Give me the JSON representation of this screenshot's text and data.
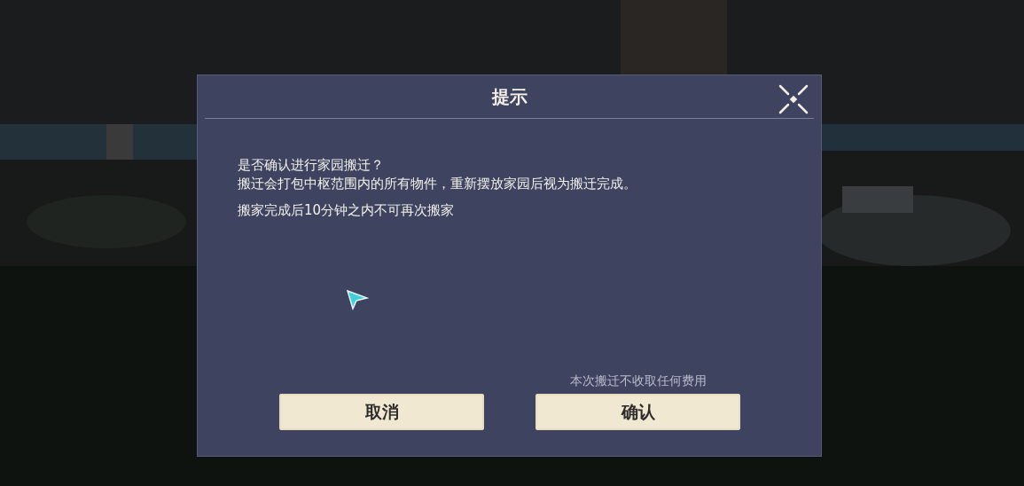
{
  "dialog": {
    "title": "提示",
    "message": [
      "是否确认进行家园搬迁？",
      "搬迁会打包中枢范围内的所有物件，重新摆放家园后视为搬迁完成。"
    ],
    "warning": "搬家完成后10分钟之内不可再次搬家",
    "note": "本次搬迁不收取任何费用",
    "buttons": [
      {
        "label": "取消"
      },
      {
        "label": "确认"
      }
    ]
  }
}
